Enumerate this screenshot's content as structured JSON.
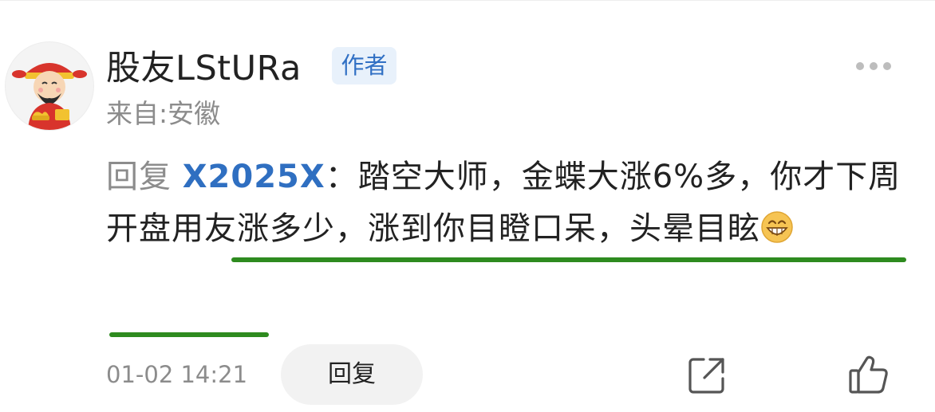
{
  "comment": {
    "username": "股友LStURa",
    "author_badge": "作者",
    "location": "来自:安徽",
    "reply_prefix": "回复 ",
    "mention": "X2025X",
    "separator": "：",
    "body_text": "踏空大师，金蝶大涨6%多，你才下周开盘用友涨多少，涨到你目瞪口呆，头晕目眩",
    "emoji": "grinning-face-icon",
    "timestamp": "01-02 14:21",
    "reply_button_label": "回复"
  },
  "icons": {
    "more": "more-dots-icon",
    "share": "share-icon",
    "like": "thumbs-up-icon"
  },
  "colors": {
    "mention_blue": "#2f6fc1",
    "badge_text": "#3170c4",
    "badge_bg": "#e8f1fb",
    "underline_green": "#2e8b1f",
    "secondary_text": "#8c8c8c"
  }
}
